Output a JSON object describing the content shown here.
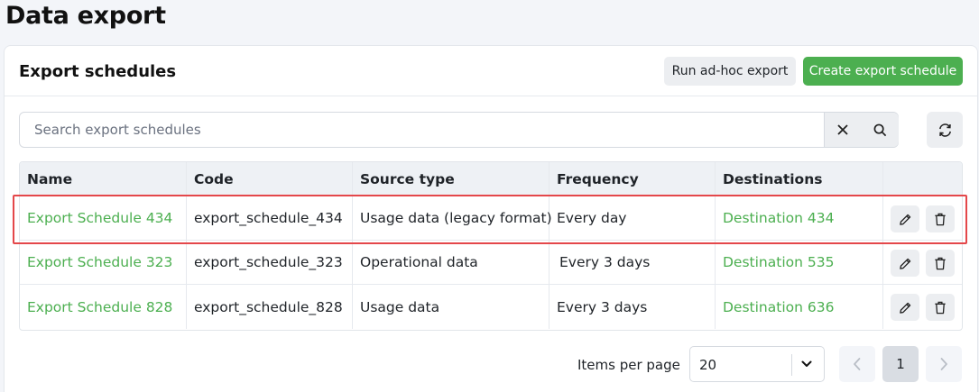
{
  "page": {
    "title": "Data export"
  },
  "card": {
    "title": "Export schedules",
    "run_adhoc_label": "Run ad-hoc export",
    "create_label": "Create export schedule"
  },
  "search": {
    "placeholder": "Search export schedules",
    "value": ""
  },
  "icons": {
    "clear": "close-icon",
    "search": "search-icon",
    "refresh": "refresh-icon",
    "edit": "pencil-icon",
    "delete": "trash-icon",
    "chevron": "chevron-down-icon",
    "prev": "chevron-left-icon",
    "next": "chevron-right-icon"
  },
  "table": {
    "columns": [
      "Name",
      "Code",
      "Source type",
      "Frequency",
      "Destinations",
      ""
    ],
    "rows": [
      {
        "name": "Export Schedule 434",
        "code": "export_schedule_434",
        "source_type": "Usage data (legacy format)",
        "frequency": "Every day",
        "destination": "Destination 434"
      },
      {
        "name": "Export Schedule 323",
        "code": "export_schedule_323",
        "source_type": "Operational data",
        "frequency": "Every 3 days",
        "destination": "Destination 535"
      },
      {
        "name": "Export Schedule 828",
        "code": "export_schedule_828",
        "source_type": "Usage data",
        "frequency": "Every 3 days",
        "destination": "Destination 636"
      }
    ]
  },
  "pagination": {
    "items_per_page_label": "Items per page",
    "items_per_page": "20",
    "current_page": "1"
  },
  "colors": {
    "accent": "#4caf50",
    "highlight": "#e4474a"
  }
}
